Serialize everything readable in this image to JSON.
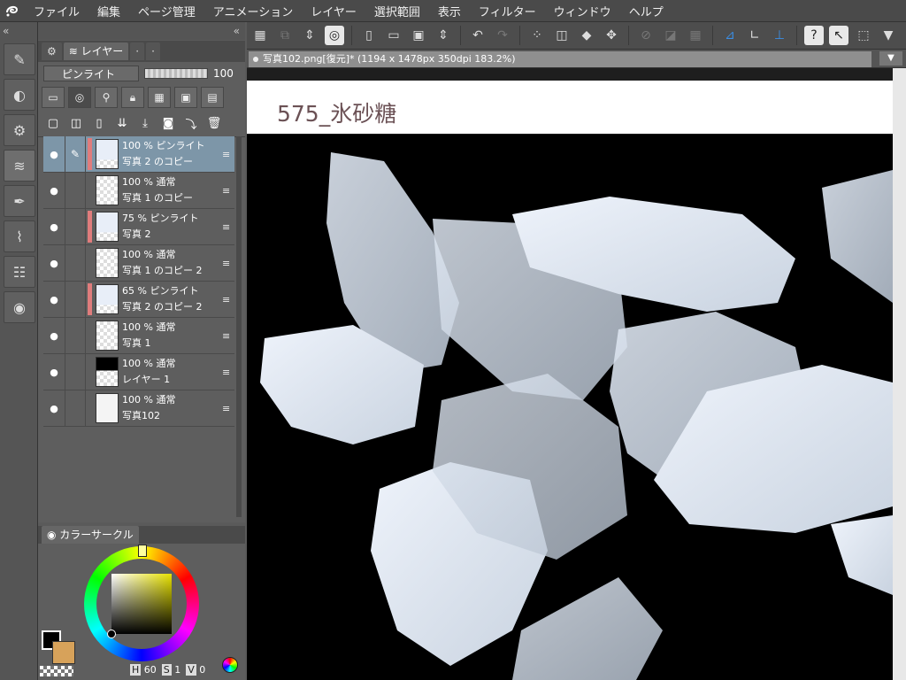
{
  "menubar": {
    "items": [
      "ファイル",
      "編集",
      "ページ管理",
      "アニメーション",
      "レイヤー",
      "選択範囲",
      "表示",
      "フィルター",
      "ウィンドウ",
      "ヘルプ"
    ]
  },
  "layer_panel": {
    "tab_label": "レイヤー",
    "blend_mode": "ピンライト",
    "opacity": "100",
    "layers": [
      {
        "line1": "100 % ピンライト",
        "line2": "写真 2 のコピー",
        "thumb": "pale",
        "clip": "#e07c7c",
        "selected": true,
        "brush": true
      },
      {
        "line1": "100 % 通常",
        "line2": "写真 1 のコピー",
        "thumb": "check",
        "clip": "",
        "selected": false,
        "brush": false
      },
      {
        "line1": "75 % ピンライト",
        "line2": "写真 2",
        "thumb": "pale",
        "clip": "#e07c7c",
        "selected": false,
        "brush": false
      },
      {
        "line1": "100 % 通常",
        "line2": "写真 1 のコピー 2",
        "thumb": "check",
        "clip": "",
        "selected": false,
        "brush": false
      },
      {
        "line1": "65 % ピンライト",
        "line2": "写真 2 のコピー 2",
        "thumb": "pale",
        "clip": "#e07c7c",
        "selected": false,
        "brush": false
      },
      {
        "line1": "100 % 通常",
        "line2": "写真 1",
        "thumb": "check",
        "clip": "",
        "selected": false,
        "brush": false
      },
      {
        "line1": "100 % 通常",
        "line2": "レイヤー 1",
        "thumb": "black",
        "clip": "",
        "selected": false,
        "brush": false
      },
      {
        "line1": "100 % 通常",
        "line2": "写真102",
        "thumb": "white",
        "clip": "",
        "selected": false,
        "brush": false
      }
    ]
  },
  "color_panel": {
    "tab_label": "カラーサークル",
    "h": "60",
    "s": "1",
    "v": "0",
    "main_color": "#000000",
    "sub_color": "#d7a25a"
  },
  "document": {
    "tab_title": "写真102.png[復元]* (1194 x 1478px 350dpi 183.2%)",
    "heading": "575_氷砂糖"
  }
}
